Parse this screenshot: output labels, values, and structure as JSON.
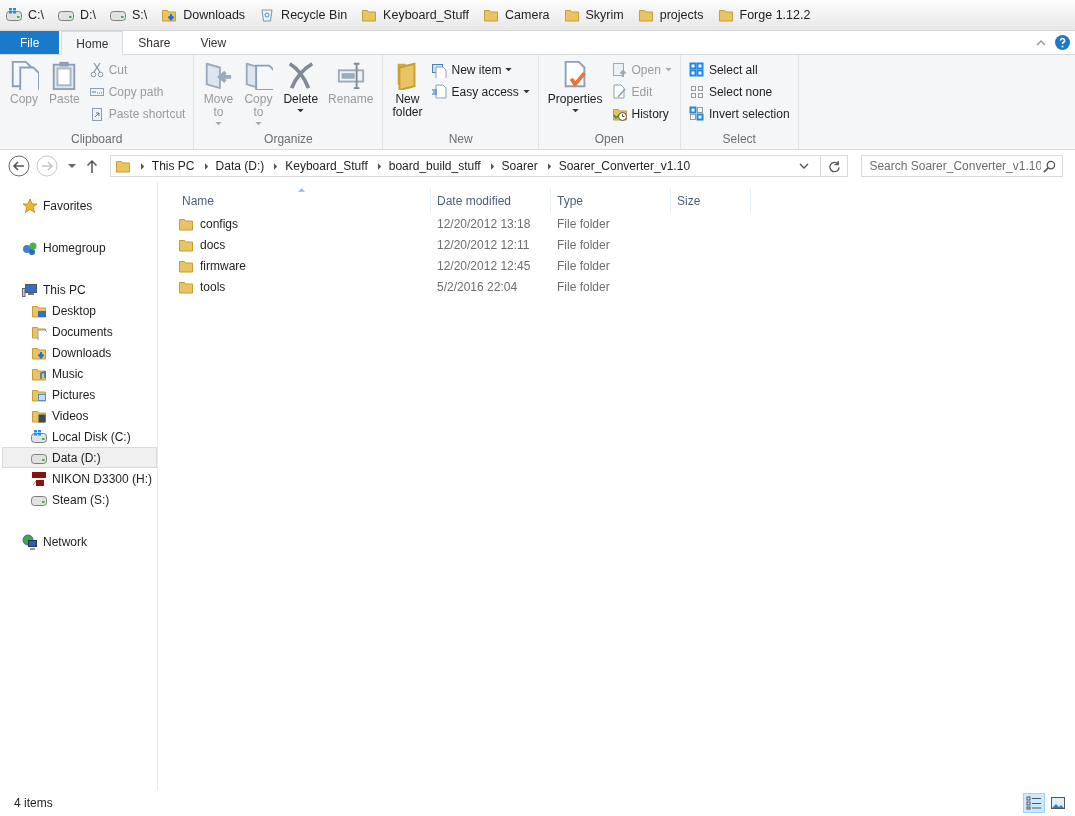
{
  "bookmarks": [
    {
      "label": "C:\\",
      "kind": "windrive"
    },
    {
      "label": "D:\\",
      "kind": "drive"
    },
    {
      "label": "S:\\",
      "kind": "drive"
    },
    {
      "label": "Downloads",
      "kind": "downloads"
    },
    {
      "label": "Recycle Bin",
      "kind": "recycle"
    },
    {
      "label": "Keyboard_Stuff",
      "kind": "folder"
    },
    {
      "label": "Camera",
      "kind": "folder"
    },
    {
      "label": "Skyrim",
      "kind": "folder"
    },
    {
      "label": "projects",
      "kind": "folder"
    },
    {
      "label": "Forge 1.12.2",
      "kind": "folder"
    }
  ],
  "ribbon": {
    "tabs": [
      {
        "label": "File",
        "kind": "file",
        "selected": false
      },
      {
        "label": "Home",
        "kind": "tab",
        "selected": true
      },
      {
        "label": "Share",
        "kind": "tab",
        "selected": false
      },
      {
        "label": "View",
        "kind": "tab",
        "selected": false
      }
    ],
    "groups": [
      {
        "label": "Clipboard",
        "items": [
          {
            "label": "Copy",
            "kind": "copy",
            "disabled": true,
            "dropdown": false
          },
          {
            "label": "Paste",
            "kind": "paste",
            "disabled": true,
            "dropdown": false
          },
          {
            "items": [
              {
                "label": "Cut",
                "kind": "cut",
                "disabled": true,
                "dropdown": false
              },
              {
                "label": "Copy path",
                "kind": "copypath",
                "disabled": true,
                "dropdown": false
              },
              {
                "label": "Paste shortcut",
                "kind": "pasteshortcut",
                "disabled": true,
                "dropdown": false
              }
            ]
          }
        ]
      },
      {
        "label": "Organize",
        "items": [
          {
            "label": "Move to",
            "kind": "moveto",
            "disabled": true,
            "dropdown": true
          },
          {
            "label": "Copy to",
            "kind": "copyto",
            "disabled": true,
            "dropdown": true
          },
          {
            "label": "Delete",
            "kind": "delete",
            "disabled": false,
            "dropdown": true
          },
          {
            "label": "Rename",
            "kind": "rename",
            "disabled": true,
            "dropdown": false
          }
        ]
      },
      {
        "label": "New",
        "items": [
          {
            "label": "New folder",
            "kind": "newfolder",
            "disabled": false,
            "dropdown": false
          },
          {
            "items": [
              {
                "label": "New item",
                "kind": "newitem",
                "disabled": false,
                "dropdown": true
              },
              {
                "label": "Easy access",
                "kind": "easyaccess",
                "disabled": false,
                "dropdown": true
              }
            ]
          }
        ]
      },
      {
        "label": "Open",
        "items": [
          {
            "label": "Properties",
            "kind": "properties",
            "disabled": false,
            "dropdown": true
          },
          {
            "items": [
              {
                "label": "Open",
                "kind": "open",
                "disabled": true,
                "dropdown": true
              },
              {
                "label": "Edit",
                "kind": "edit",
                "disabled": true,
                "dropdown": false
              },
              {
                "label": "History",
                "kind": "history",
                "disabled": false,
                "dropdown": false
              }
            ]
          }
        ]
      },
      {
        "label": "Select",
        "items": [
          {
            "items": [
              {
                "label": "Select all",
                "kind": "selectall",
                "disabled": false,
                "dropdown": false
              },
              {
                "label": "Select none",
                "kind": "selectnone",
                "disabled": false,
                "dropdown": false
              },
              {
                "label": "Invert selection",
                "kind": "invert",
                "disabled": false,
                "dropdown": false
              }
            ]
          }
        ]
      }
    ]
  },
  "navigation": {
    "back_disabled": false,
    "forward_disabled": true,
    "breadcrumb": [
      "This PC",
      "Data (D:)",
      "Keyboard_Stuff",
      "board_build_stuff",
      "Soarer",
      "Soarer_Converter_v1.10"
    ],
    "search": {
      "placeholder": "Search Soarer_Converter_v1.10"
    }
  },
  "sidebar": [
    {
      "label": "Favorites",
      "kind": "star",
      "selected": false
    },
    {
      "label": "Homegroup",
      "kind": "homegroup",
      "selected": false
    },
    {
      "label": "This PC",
      "kind": "computer",
      "selected": false,
      "children": [
        {
          "label": "Desktop",
          "kind": "desktop",
          "selected": false
        },
        {
          "label": "Documents",
          "kind": "documents",
          "selected": false
        },
        {
          "label": "Downloads",
          "kind": "downloads",
          "selected": false
        },
        {
          "label": "Music",
          "kind": "music",
          "selected": false
        },
        {
          "label": "Pictures",
          "kind": "pictures",
          "selected": false
        },
        {
          "label": "Videos",
          "kind": "videos",
          "selected": false
        },
        {
          "label": "Local Disk (C:)",
          "kind": "windrive",
          "selected": false
        },
        {
          "label": "Data (D:)",
          "kind": "drive",
          "selected": true
        },
        {
          "label": "NIKON D3300 (H:)",
          "kind": "sdcard",
          "selected": false
        },
        {
          "label": "Steam (S:)",
          "kind": "drive",
          "selected": false
        }
      ]
    },
    {
      "label": "Network",
      "kind": "network",
      "selected": false
    }
  ],
  "table": {
    "columns": [
      {
        "label": "Name",
        "sorted": true
      },
      {
        "label": "Date modified",
        "sorted": false
      },
      {
        "label": "Type",
        "sorted": false
      },
      {
        "label": "Size",
        "sorted": false
      }
    ],
    "rows": [
      {
        "name": "configs",
        "date_modified": "12/20/2012 13:18",
        "type": "File folder"
      },
      {
        "name": "docs",
        "date_modified": "12/20/2012 12:11",
        "type": "File folder"
      },
      {
        "name": "firmware",
        "date_modified": "12/20/2012 12:45",
        "type": "File folder"
      },
      {
        "name": "tools",
        "date_modified": "5/2/2016 22:04",
        "type": "File folder"
      }
    ]
  },
  "status_bar": {
    "item_count": "4 items",
    "views": [
      {
        "kind": "details",
        "selected": true
      },
      {
        "kind": "thumbnails",
        "selected": false
      }
    ]
  }
}
